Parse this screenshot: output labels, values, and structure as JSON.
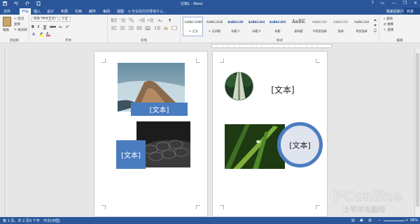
{
  "titlebar": {
    "title": "文档1 - Word",
    "quick_access": [
      "save-icon",
      "undo-icon",
      "redo-icon",
      "print-preview-icon"
    ],
    "window_controls": [
      "?",
      "▭",
      "—",
      "❐",
      "✕"
    ]
  },
  "tabs": {
    "file": "文件",
    "items": [
      "开始",
      "插入",
      "设计",
      "布局",
      "引用",
      "邮件",
      "审阅",
      "视图"
    ],
    "active": "开始",
    "tell_me": "♀ 告诉我您想要做什么...",
    "sign_in": "陈新民账户",
    "share": "共享"
  },
  "ribbon": {
    "clipboard": {
      "paste": "粘贴",
      "cut": "✂ 剪切",
      "copy": "复制",
      "format_painter": "✎ 格式刷",
      "label": "剪贴板"
    },
    "font": {
      "font_name": "宋体 (中文正文)",
      "font_size": "小五",
      "buttons": [
        "B",
        "I",
        "U",
        "abc",
        "x₂",
        "x²"
      ],
      "label": "字体"
    },
    "paragraph": {
      "label": "段落"
    },
    "styles": {
      "items": [
        {
          "sample": "AaBbCcDdEt",
          "name": "↵ 正文"
        },
        {
          "sample": "AaBbCcDdE",
          "name": "↵ 无间隔"
        },
        {
          "sample": "AaBbCcDt",
          "name": "标题 1"
        },
        {
          "sample": "AaBbCcDd",
          "name": "标题 2"
        },
        {
          "sample": "AaBbCcDd",
          "name": "标题"
        },
        {
          "sample": "AaBE",
          "name": "副标题"
        },
        {
          "sample": "AaBbCcDd",
          "name": "不明显强调"
        },
        {
          "sample": "AaBbCcDd",
          "name": "强调"
        },
        {
          "sample": "AaBbCcDd",
          "name": "明显强调"
        }
      ],
      "label": "样式"
    },
    "editing": {
      "find": "查找",
      "replace": "替换",
      "select": "选择",
      "label": "编辑"
    }
  },
  "document": {
    "page1_caption_1": "[文本]",
    "page1_caption_2": "[文本]",
    "page2_caption_1": "[文本]",
    "page2_caption_2": "[文本]"
  },
  "statusbar": {
    "page": "第 1 页，共 2 页",
    "words": "0 个字",
    "language": "中文(中国)",
    "zoom": "56%"
  },
  "colors": {
    "word_blue": "#2b579a",
    "text_box_blue": "#4a7cc0",
    "circle_fill": "#dfe4ee",
    "circle_ring": "#4a7cc0"
  }
}
